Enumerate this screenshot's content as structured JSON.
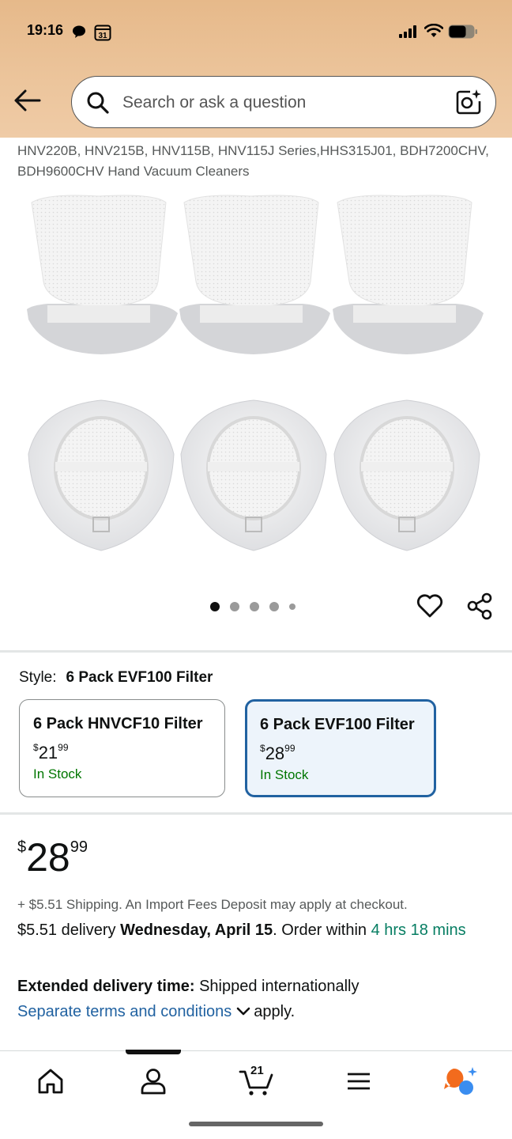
{
  "status_bar": {
    "time": "19:16",
    "calendar_day": "31"
  },
  "search": {
    "placeholder": "Search or ask a question"
  },
  "product": {
    "title_fragment": "HNV220B, HNV215B, HNV115B, HNV115J Series,HHS315J01, BDH7200CHV, BDH9600CHV Hand Vacuum Cleaners",
    "image_count": 5,
    "image_index": 1
  },
  "style": {
    "label": "Style:",
    "selected": "6 Pack EVF100 Filter",
    "options": [
      {
        "name": "6 Pack HNVCF10 Filter",
        "currency": "$",
        "price_whole": "21",
        "price_fraction": "99",
        "stock": "In Stock",
        "selected": false
      },
      {
        "name": "6 Pack EVF100 Filter",
        "currency": "$",
        "price_whole": "28",
        "price_fraction": "99",
        "stock": "In Stock",
        "selected": true
      }
    ]
  },
  "price": {
    "currency": "$",
    "whole": "28",
    "fraction": "99"
  },
  "shipping": "+ $5.51 Shipping. An Import Fees Deposit may apply at checkout.",
  "delivery": {
    "prefix": "$5.51 delivery ",
    "date": "Wednesday, April 15",
    "middle": ". Order within ",
    "countdown": "4 hrs 18 mins"
  },
  "extended": {
    "label": "Extended delivery time:",
    "text": " Shipped internationally"
  },
  "terms": {
    "link": "Separate terms and conditions",
    "suffix": "apply."
  },
  "nav": {
    "cart_count": "21",
    "active_index": 1
  },
  "colors": {
    "header": "#e8bc8f",
    "link": "#2162a1",
    "stock_green": "#007600",
    "selected_border": "#2162a1"
  }
}
